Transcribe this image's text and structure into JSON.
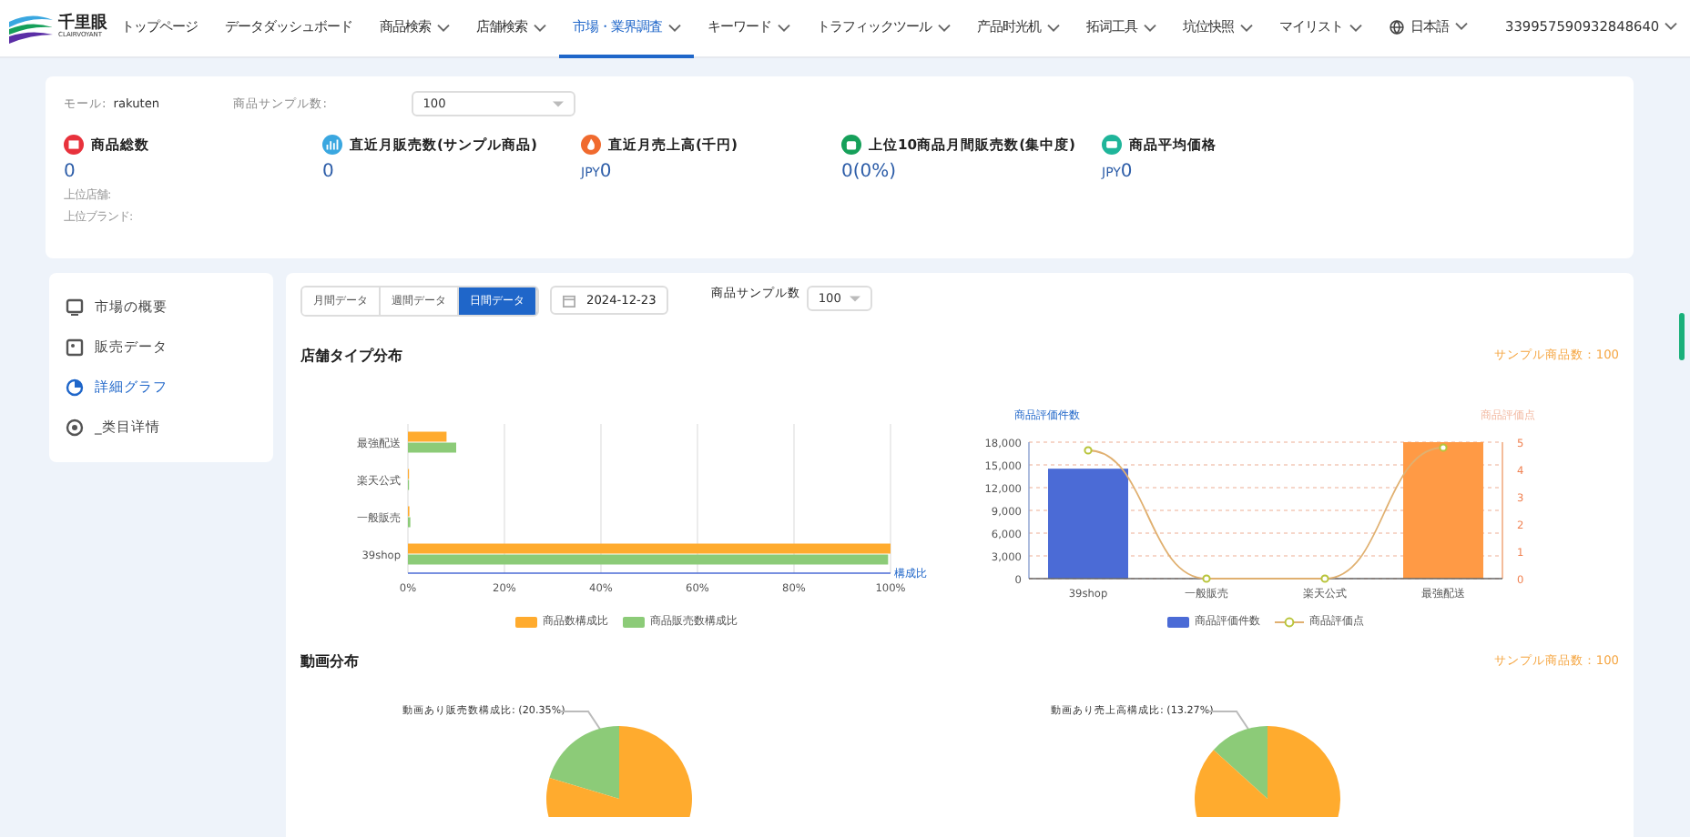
{
  "logo": {
    "name": "千里眼",
    "tagline": "CLAIRVOYANT"
  },
  "nav": [
    {
      "label": "トップページ",
      "dropdown": false,
      "selected": false
    },
    {
      "label": "データダッシュボード",
      "dropdown": false,
      "selected": false
    },
    {
      "label": "商品検索",
      "dropdown": true,
      "selected": false
    },
    {
      "label": "店舗検索",
      "dropdown": true,
      "selected": false
    },
    {
      "label": "市場・業界調査",
      "dropdown": true,
      "selected": true
    },
    {
      "label": "キーワード",
      "dropdown": true,
      "selected": false
    },
    {
      "label": "トラフィックツール",
      "dropdown": true,
      "selected": false
    },
    {
      "label": "产品时光机",
      "dropdown": true,
      "selected": false
    },
    {
      "label": "拓词工具",
      "dropdown": true,
      "selected": false
    },
    {
      "label": "坑位快照",
      "dropdown": true,
      "selected": false
    },
    {
      "label": "マイリスト",
      "dropdown": true,
      "selected": false
    }
  ],
  "language": "日本語",
  "user_id": "339957590932848640",
  "filters": {
    "mall_label": "モール:",
    "mall": "rakuten",
    "sample_label": "商品サンプル数:",
    "sample": "100"
  },
  "stats": [
    {
      "title": "商品総数",
      "value": "0",
      "color": "#e8323c",
      "kind": "box"
    },
    {
      "title": "直近月販売数(サンプル商品)",
      "value": "0",
      "color": "#3aa7e0",
      "kind": "chart"
    },
    {
      "title": "直近月売上高(千円)",
      "prefix": "JPY",
      "value": "0",
      "color": "#f06a2e",
      "kind": "flame"
    },
    {
      "title": "上位10商品月間販売数(集中度)",
      "value": "0(0%)",
      "color": "#16a05a",
      "kind": "bag"
    },
    {
      "title": "商品平均価格",
      "prefix": "JPY",
      "value": "0",
      "color": "#1fb59a",
      "kind": "ticket"
    }
  ],
  "top_labels": [
    "上位店舗:",
    "上位ブランド:"
  ],
  "sidebar": {
    "items": [
      {
        "label": "市場の概要",
        "kind": "monitor",
        "selected": false
      },
      {
        "label": "販売データ",
        "kind": "image",
        "selected": false
      },
      {
        "label": "詳細グラフ",
        "kind": "pie",
        "selected": true
      },
      {
        "label": "_类目详情",
        "kind": "target",
        "selected": false
      }
    ]
  },
  "period_tabs": [
    {
      "label": "月間データ",
      "selected": false
    },
    {
      "label": "週間データ",
      "selected": false
    },
    {
      "label": "日間データ",
      "selected": true
    }
  ],
  "date": "2024-12-23",
  "sample_label": "商品サンプル数",
  "sample": "100",
  "shop_section": {
    "title": "店舗タイプ分布",
    "sample_note": "サンプル商品数：100",
    "chart_data": {
      "type": "bar",
      "orientation": "horizontal",
      "xlabel": "構成比",
      "grid": true,
      "legend": true,
      "categories": [
        "最強配送",
        "楽天公式",
        "一般販売",
        "39shop"
      ],
      "series": [
        {
          "name": "商品数構成比",
          "color": "#ffab2e",
          "values": [
            8,
            0,
            0.3,
            100
          ]
        },
        {
          "name": "商品販売数構成比",
          "color": "#8ccb78",
          "values": [
            10,
            0,
            0.5,
            99.5
          ]
        }
      ],
      "xlim": [
        0,
        100
      ],
      "xticks": [
        {
          "value": 0,
          "label": "0%"
        },
        {
          "value": 20,
          "label": "20%"
        },
        {
          "value": 40,
          "label": "40%"
        },
        {
          "value": 60,
          "label": "60%"
        },
        {
          "value": 80,
          "label": "80%"
        },
        {
          "value": 100,
          "label": "100%"
        }
      ]
    },
    "rating_chart": {
      "chart_data": {
        "type": "bar",
        "ylabel": "商品評価件数",
        "y2label": "商品評価点",
        "grid": true,
        "legend": true,
        "categories": [
          "39shop",
          "一般販売",
          "楽天公式",
          "最強配送"
        ],
        "series": [
          {
            "name": "商品評価件数",
            "color": "#4b6bd6",
            "values": [
              14500,
              0,
              0,
              null
            ]
          },
          {
            "name": null,
            "color": "#ff9a45",
            "values": [
              null,
              null,
              null,
              18000
            ]
          },
          {
            "name": "商品評価点",
            "color": "#e0b070",
            "values": [
              4.7,
              0,
              0,
              4.8
            ]
          }
        ],
        "ylim": [
          0,
          18000
        ],
        "yticks": [
          {
            "value": 0,
            "label": "0"
          },
          {
            "value": 3000,
            "label": "3,000"
          },
          {
            "value": 6000,
            "label": "6,000"
          },
          {
            "value": 9000,
            "label": "9,000"
          },
          {
            "value": 12000,
            "label": "12,000"
          },
          {
            "value": 15000,
            "label": "15,000"
          },
          {
            "value": 18000,
            "label": "18,000"
          }
        ],
        "y2lim": [
          0,
          5
        ],
        "y2ticks": [
          0,
          1,
          2,
          3,
          4,
          5
        ]
      }
    }
  },
  "video_section": {
    "title": "動画分布",
    "sample_note": "サンプル商品数：100",
    "pies": [
      {
        "chart_data": {
          "type": "pie",
          "categories": [
            "動画あり販売数構成比: (20.35%)",
            null
          ],
          "series": [
            {
              "name": null,
              "colors": [
                "#8ccb78",
                "#ffab2e"
              ],
              "values": [
                20.35,
                79.65
              ]
            }
          ]
        }
      },
      {
        "chart_data": {
          "type": "pie",
          "categories": [
            "動画あり売上高構成比: (13.27%)",
            null
          ],
          "series": [
            {
              "name": null,
              "colors": [
                "#8ccb78",
                "#ffab2e"
              ],
              "values": [
                13.27,
                86.73
              ]
            }
          ]
        }
      }
    ]
  }
}
